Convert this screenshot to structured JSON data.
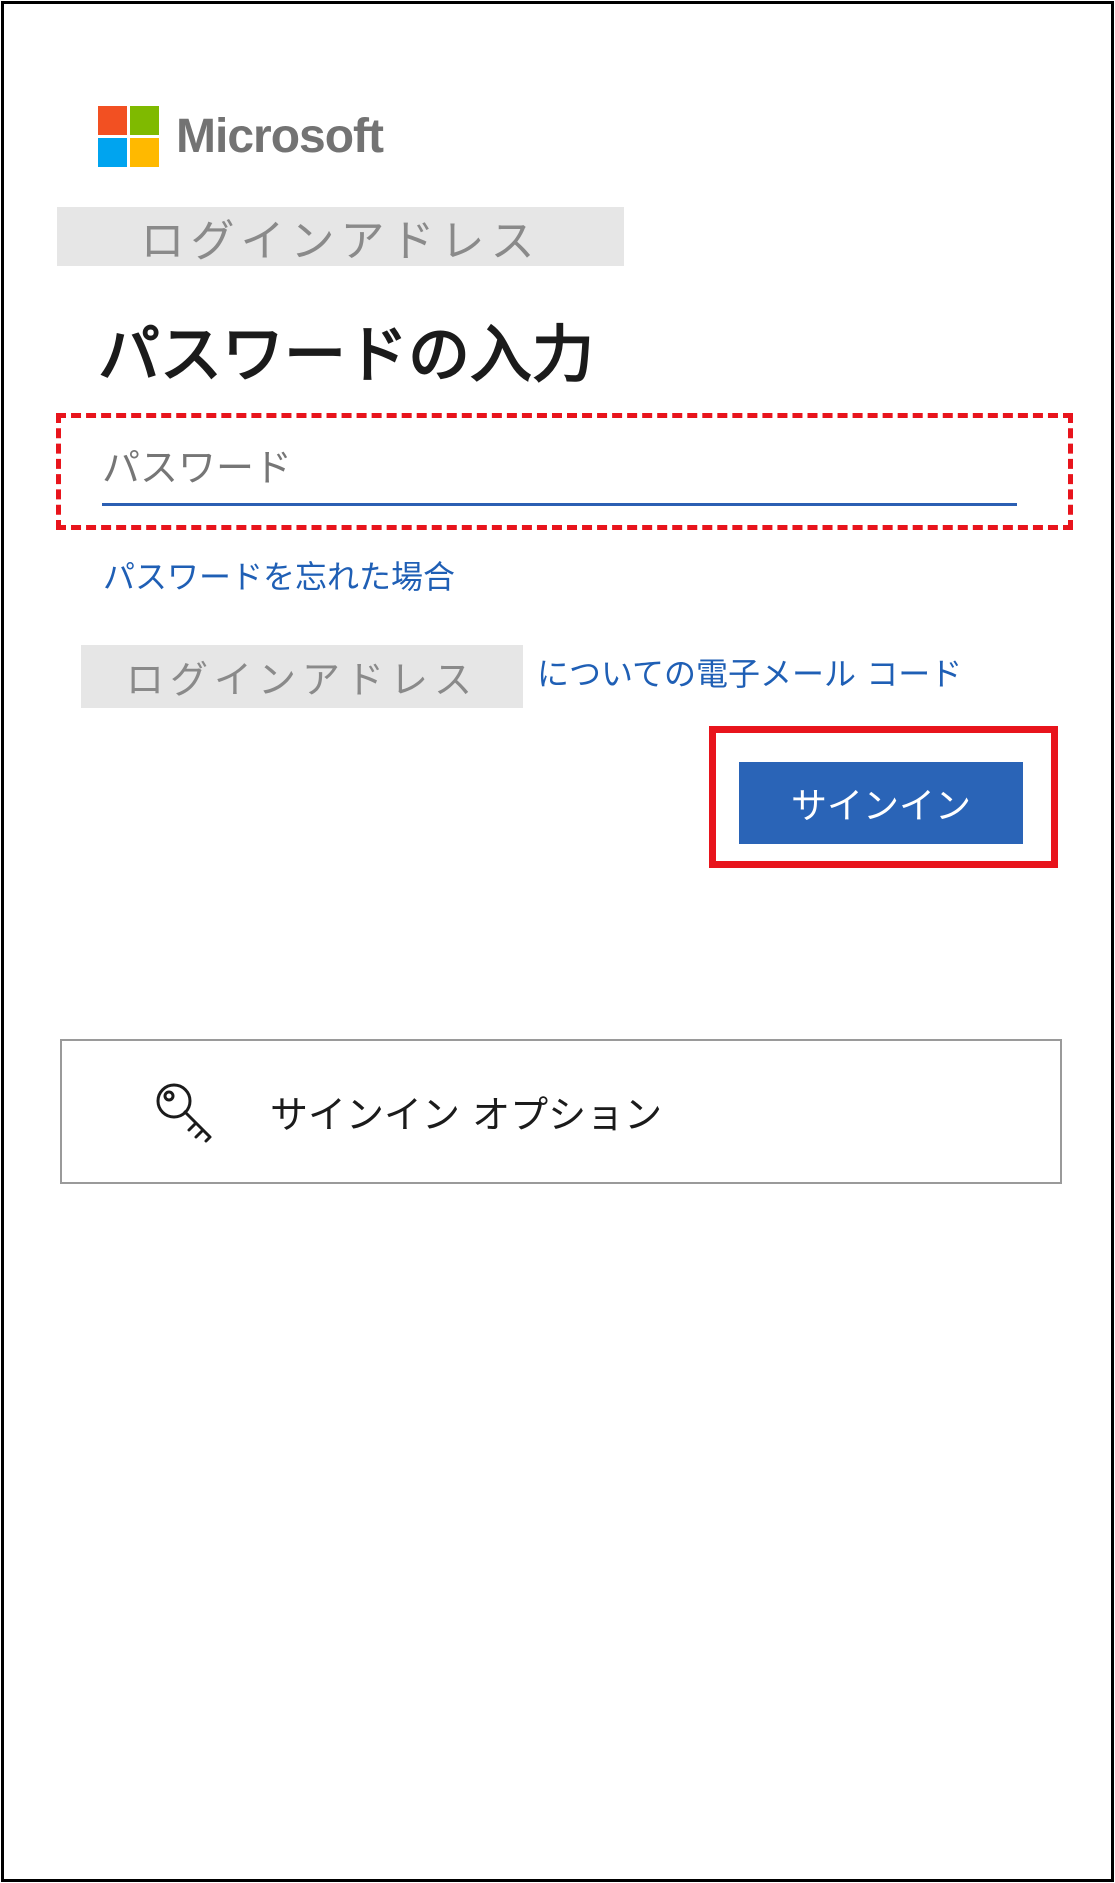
{
  "brand": {
    "name": "Microsoft",
    "colors": {
      "red": "#f25022",
      "green": "#7fba00",
      "blue": "#00a4ef",
      "yellow": "#ffb900"
    }
  },
  "account": {
    "login_address_top": "ログインアドレス",
    "login_address_inline": "ログインアドレス"
  },
  "page": {
    "title": "パスワードの入力"
  },
  "password": {
    "placeholder": "パスワード",
    "value": ""
  },
  "links": {
    "forgot_password": "パスワードを忘れた場合",
    "email_code": "についての電子メール コード"
  },
  "buttons": {
    "sign_in": "サインイン"
  },
  "options": {
    "label": "サインイン オプション",
    "icon": "key-icon"
  },
  "theme": {
    "accent": "#2a64b7",
    "link": "#1f5fb5",
    "highlight": "#e8141c"
  }
}
